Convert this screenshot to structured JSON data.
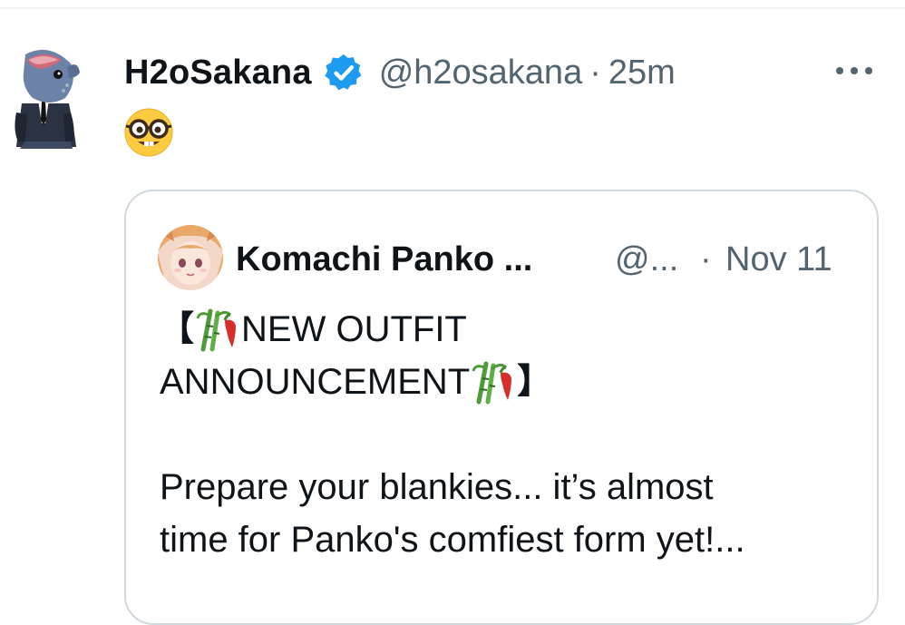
{
  "tweet": {
    "author": {
      "display_name": "H2oSakana",
      "handle": "@h2osakana",
      "verified": true,
      "avatar_icon": "fish-in-suit-avatar"
    },
    "separator": "·",
    "time": "25m",
    "more_icon": "more-options-icon",
    "text_emoji": "nerd-face-emoji"
  },
  "quote": {
    "author": {
      "display_name": "Komachi Panko ...",
      "handle": "@...",
      "avatar_icon": "anime-girl-avatar"
    },
    "separator": "·",
    "time": "Nov 11",
    "lines": {
      "l1_open": "【",
      "l1_text": "NEW OUTFIT",
      "l2_text": "ANNOUNCEMENT",
      "l2_close": "】",
      "l3": "Prepare your blankies... it’s almost",
      "l4": "time for Panko's comfiest form yet!..."
    },
    "inline_emoji": "bamboo-chili-emoji"
  },
  "colors": {
    "text_primary": "#0f1419",
    "text_secondary": "#536471",
    "verified_blue": "#1d9bf0",
    "border": "#cfd9de"
  }
}
